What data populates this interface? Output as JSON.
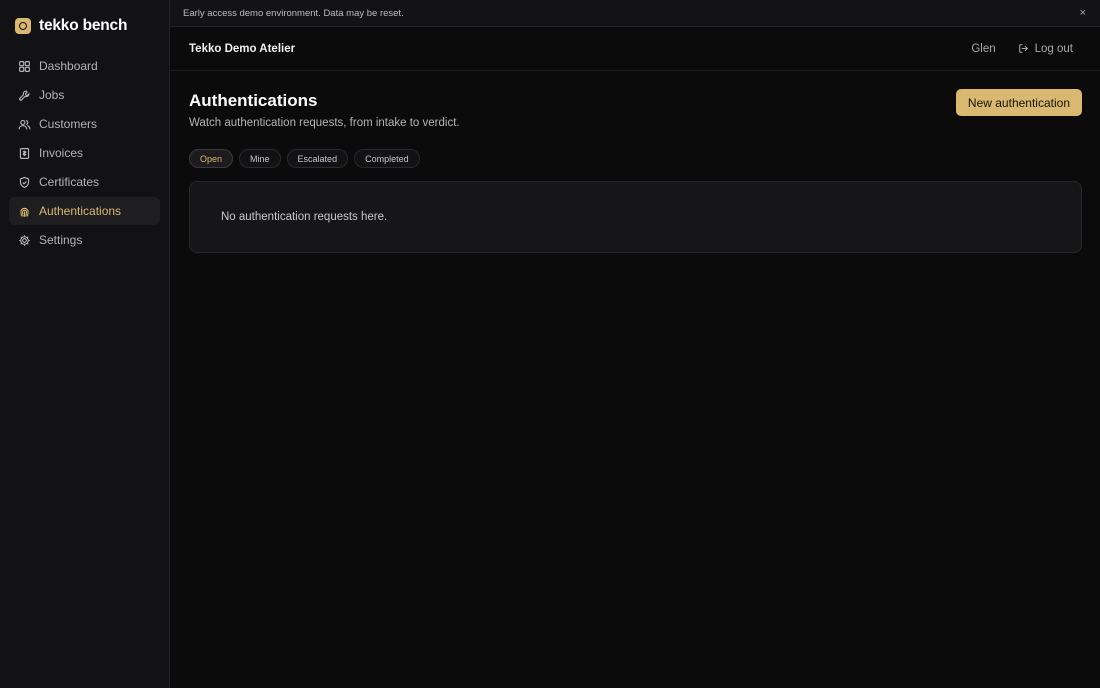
{
  "brand": {
    "name": "tekko bench",
    "accent": "#d9b871"
  },
  "sidebar": {
    "items": [
      {
        "label": "Dashboard",
        "icon": "grid-icon"
      },
      {
        "label": "Jobs",
        "icon": "wrench-icon"
      },
      {
        "label": "Customers",
        "icon": "users-icon"
      },
      {
        "label": "Invoices",
        "icon": "receipt-icon"
      },
      {
        "label": "Certificates",
        "icon": "shield-icon"
      },
      {
        "label": "Authentications",
        "icon": "fingerprint-icon",
        "active": true
      },
      {
        "label": "Settings",
        "icon": "gear-icon"
      }
    ]
  },
  "banner": {
    "text": "Early access demo environment. Data may be reset.",
    "close": "×"
  },
  "topbar": {
    "org": "Tekko Demo Atelier",
    "user": "Glen",
    "logout": "Log out"
  },
  "page": {
    "title": "Authentications",
    "subtitle": "Watch authentication requests, from intake to verdict.",
    "new_button": "New authentication",
    "filters": [
      {
        "label": "Open",
        "active": true
      },
      {
        "label": "Mine"
      },
      {
        "label": "Escalated"
      },
      {
        "label": "Completed"
      }
    ],
    "empty_message": "No authentication requests here."
  }
}
